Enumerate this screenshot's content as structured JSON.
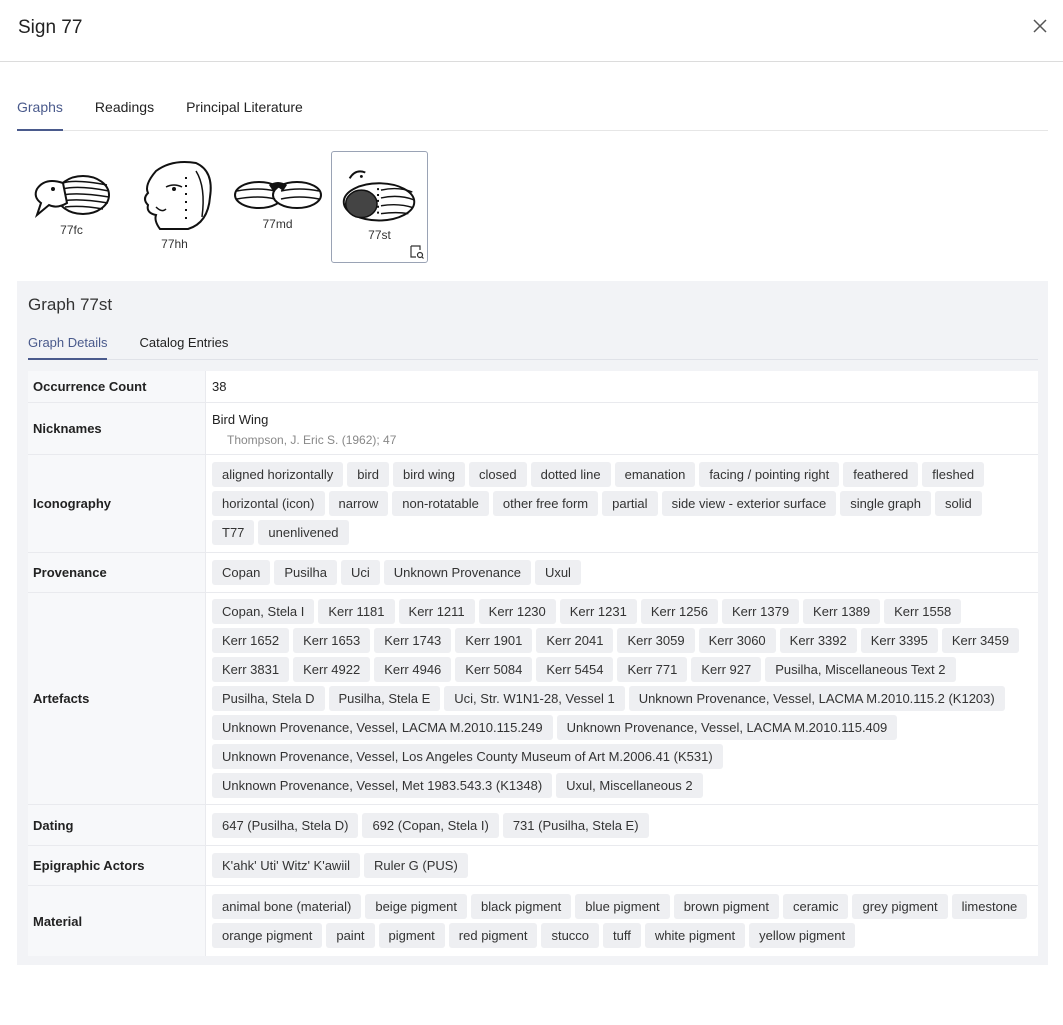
{
  "dialog": {
    "title": "Sign 77",
    "close_icon": "close-icon"
  },
  "main_tabs": [
    "Graphs",
    "Readings",
    "Principal Literature"
  ],
  "graphs": [
    {
      "label": "77fc"
    },
    {
      "label": "77hh"
    },
    {
      "label": "77md"
    },
    {
      "label": "77st"
    }
  ],
  "panel": {
    "title": "Graph 77st",
    "tabs": [
      "Graph Details",
      "Catalog Entries"
    ]
  },
  "details": {
    "occurrence": {
      "label": "Occurrence Count",
      "value": "38"
    },
    "nicknames": {
      "label": "Nicknames",
      "name": "Bird Wing",
      "source": "Thompson, J. Eric S. (1962); 47"
    },
    "iconography": {
      "label": "Iconography",
      "tags": [
        "aligned horizontally",
        "bird",
        "bird wing",
        "closed",
        "dotted line",
        "emanation",
        "facing / pointing right",
        "feathered",
        "fleshed",
        "horizontal (icon)",
        "narrow",
        "non-rotatable",
        "other free form",
        "partial",
        "side view - exterior surface",
        "single graph",
        "solid",
        "T77",
        "unenlivened"
      ]
    },
    "provenance": {
      "label": "Provenance",
      "tags": [
        "Copan",
        "Pusilha",
        "Uci",
        "Unknown Provenance",
        "Uxul"
      ]
    },
    "artefacts": {
      "label": "Artefacts",
      "tags": [
        "Copan, Stela I",
        "Kerr 1181",
        "Kerr 1211",
        "Kerr 1230",
        "Kerr 1231",
        "Kerr 1256",
        "Kerr 1379",
        "Kerr 1389",
        "Kerr 1558",
        "Kerr 1652",
        "Kerr 1653",
        "Kerr 1743",
        "Kerr 1901",
        "Kerr 2041",
        "Kerr 3059",
        "Kerr 3060",
        "Kerr 3392",
        "Kerr 3395",
        "Kerr 3459",
        "Kerr 3831",
        "Kerr 4922",
        "Kerr 4946",
        "Kerr 5084",
        "Kerr 5454",
        "Kerr 771",
        "Kerr 927",
        "Pusilha, Miscellaneous Text 2",
        "Pusilha, Stela D",
        "Pusilha, Stela E",
        "Uci, Str. W1N1-28, Vessel 1",
        "Unknown Provenance, Vessel, LACMA M.2010.115.2 (K1203)",
        "Unknown Provenance, Vessel, LACMA M.2010.115.249",
        "Unknown Provenance, Vessel, LACMA M.2010.115.409",
        "Unknown Provenance, Vessel, Los Angeles County Museum of Art M.2006.41 (K531)",
        "Unknown Provenance, Vessel, Met 1983.543.3 (K1348)",
        "Uxul, Miscellaneous 2"
      ]
    },
    "dating": {
      "label": "Dating",
      "tags": [
        "647 (Pusilha, Stela D)",
        "692 (Copan, Stela I)",
        "731 (Pusilha, Stela E)"
      ]
    },
    "actors": {
      "label": "Epigraphic Actors",
      "tags": [
        "K'ahk' Uti' Witz' K'awiil",
        "Ruler G (PUS)"
      ]
    },
    "material": {
      "label": "Material",
      "tags": [
        "animal bone (material)",
        "beige pigment",
        "black pigment",
        "blue pigment",
        "brown pigment",
        "ceramic",
        "grey pigment",
        "limestone",
        "orange pigment",
        "paint",
        "pigment",
        "red pigment",
        "stucco",
        "tuff",
        "white pigment",
        "yellow pigment"
      ]
    }
  }
}
